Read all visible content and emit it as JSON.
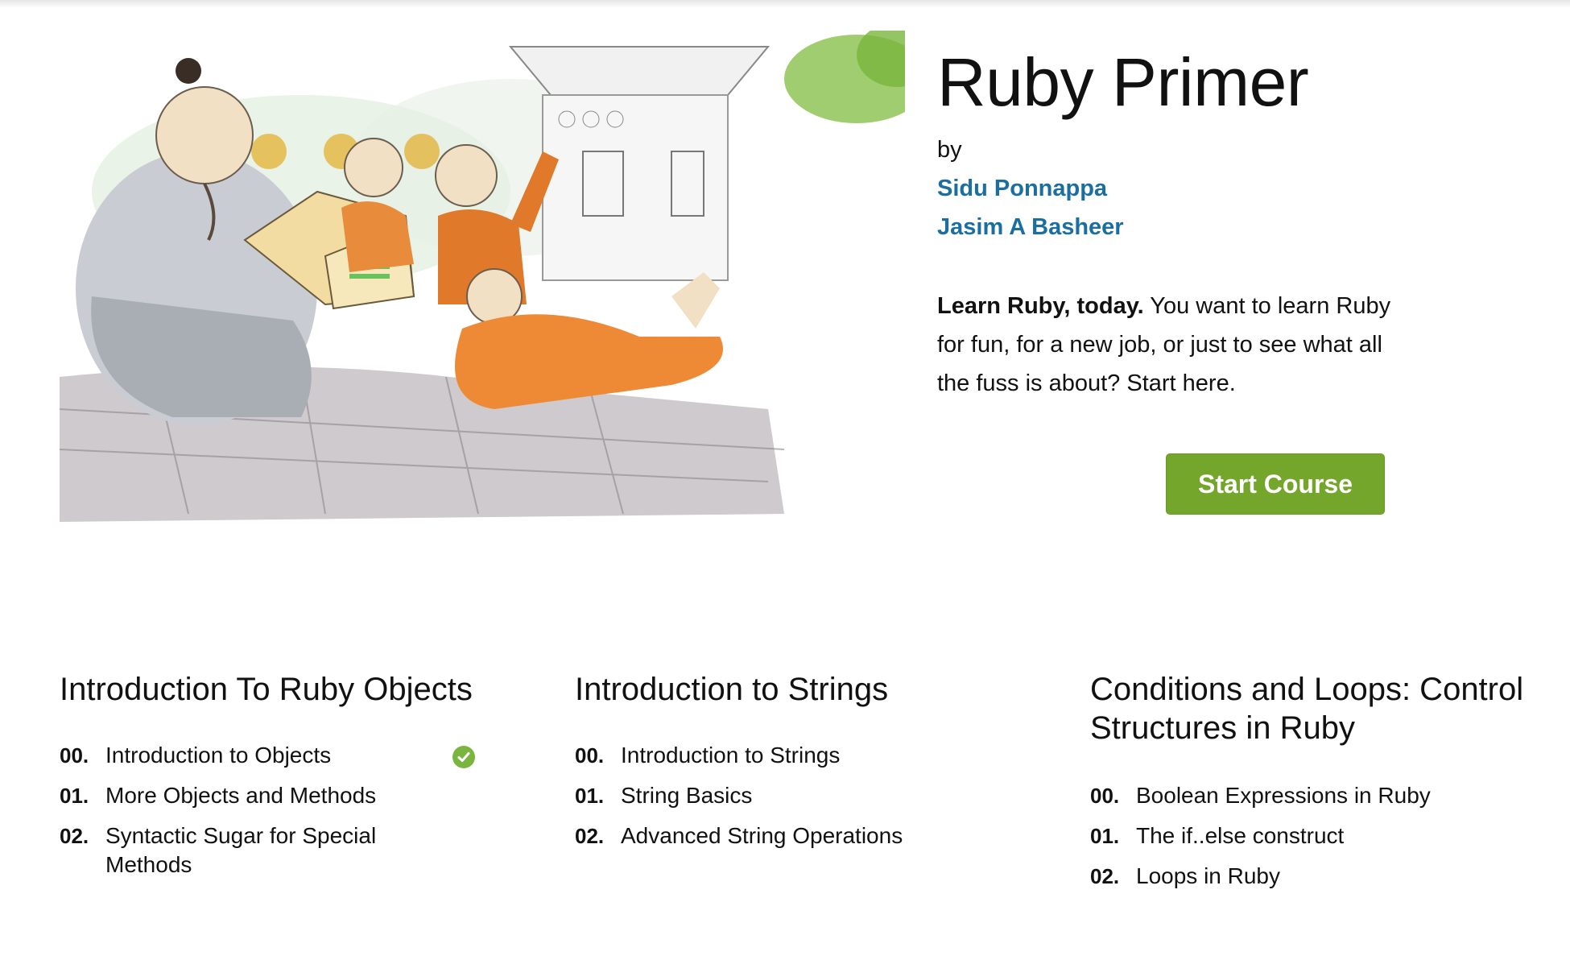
{
  "course": {
    "title": "Ruby Primer",
    "by_label": "by",
    "authors": [
      "Sidu Ponnappa",
      "Jasim A Basheer"
    ],
    "tagline_bold": "Learn Ruby, today.",
    "tagline_rest": " You want to learn Ruby for fun, for a new job, or just to see what all the fuss is about? Start here.",
    "start_button": "Start Course",
    "accent_color": "#74a62c",
    "link_color": "#1a6fa0"
  },
  "chapters": [
    {
      "title": "Introduction To Ruby Objects",
      "lessons": [
        {
          "num": "00.",
          "title": "Introduction to Objects",
          "completed": true
        },
        {
          "num": "01.",
          "title": "More Objects and Methods",
          "completed": false
        },
        {
          "num": "02.",
          "title": "Syntactic Sugar for Special Methods",
          "completed": false
        }
      ]
    },
    {
      "title": "Introduction to Strings",
      "lessons": [
        {
          "num": "00.",
          "title": "Introduction to Strings",
          "completed": false
        },
        {
          "num": "01.",
          "title": "String Basics",
          "completed": false
        },
        {
          "num": "02.",
          "title": "Advanced String Operations",
          "completed": false
        }
      ]
    },
    {
      "title": "Conditions and Loops: Control Structures in Ruby",
      "lessons": [
        {
          "num": "00.",
          "title": "Boolean Expressions in Ruby",
          "completed": false
        },
        {
          "num": "01.",
          "title": "The if..else construct",
          "completed": false
        },
        {
          "num": "02.",
          "title": "Loops in Ruby",
          "completed": false
        }
      ]
    }
  ],
  "icons": {
    "completed": "checkmark-circle-icon"
  }
}
